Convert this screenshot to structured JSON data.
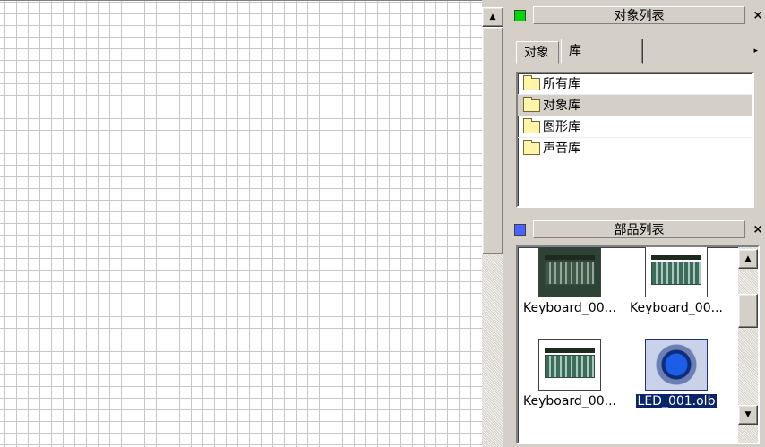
{
  "object_panel": {
    "title": "对象列表",
    "swatch_color": "#00d800",
    "close": "×",
    "tabs": [
      {
        "label": "对象"
      },
      {
        "label": "库",
        "active": true
      }
    ],
    "tab_scroll_arrow": "▸",
    "libraries": [
      {
        "label": "所有库",
        "icon": "folder-icon"
      },
      {
        "label": "对象库",
        "icon": "folder-icon",
        "selected": true
      },
      {
        "label": "图形库",
        "icon": "folder-icon"
      },
      {
        "label": "声音库",
        "icon": "folder-icon"
      }
    ]
  },
  "parts_panel": {
    "title": "部品列表",
    "swatch_color": "#4a62ff",
    "close": "×",
    "items": [
      {
        "label": "Keyboard_00...",
        "thumb": "keyboard-dark"
      },
      {
        "label": "Keyboard_00...",
        "thumb": "keyboard-light"
      },
      {
        "label": "Keyboard_00...",
        "thumb": "keyboard-light"
      },
      {
        "label": "LED_001.olb",
        "thumb": "led",
        "selected": true
      }
    ]
  },
  "scrollbar": {
    "up_arrow": "▲",
    "down_arrow": "▼"
  }
}
